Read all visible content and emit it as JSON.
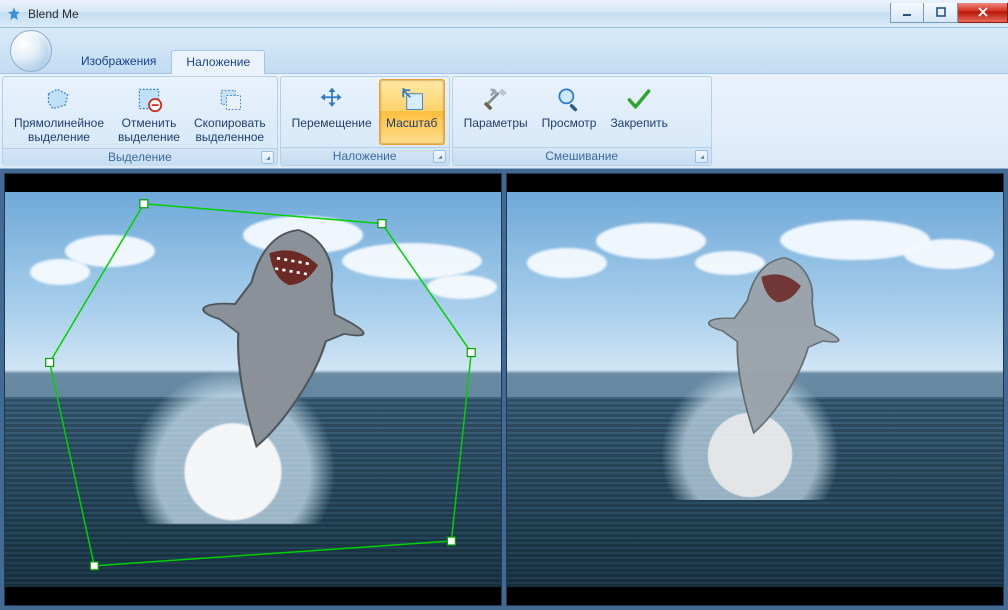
{
  "window": {
    "title": "Blend Me"
  },
  "tabs": {
    "tab_images": "Изображения",
    "tab_overlay": "Наложение"
  },
  "ribbon": {
    "group_selection": {
      "label": "Выделение",
      "btn_poly_l1": "Прямолинейное",
      "btn_poly_l2": "выделение",
      "btn_cancel_l1": "Отменить",
      "btn_cancel_l2": "выделение",
      "btn_copy_l1": "Скопировать",
      "btn_copy_l2": "выделенное"
    },
    "group_overlay": {
      "label": "Наложение",
      "btn_move": "Перемещение",
      "btn_scale": "Масштаб"
    },
    "group_blend": {
      "label": "Смешивание",
      "btn_params": "Параметры",
      "btn_preview": "Просмотр",
      "btn_commit": "Закрепить"
    }
  }
}
